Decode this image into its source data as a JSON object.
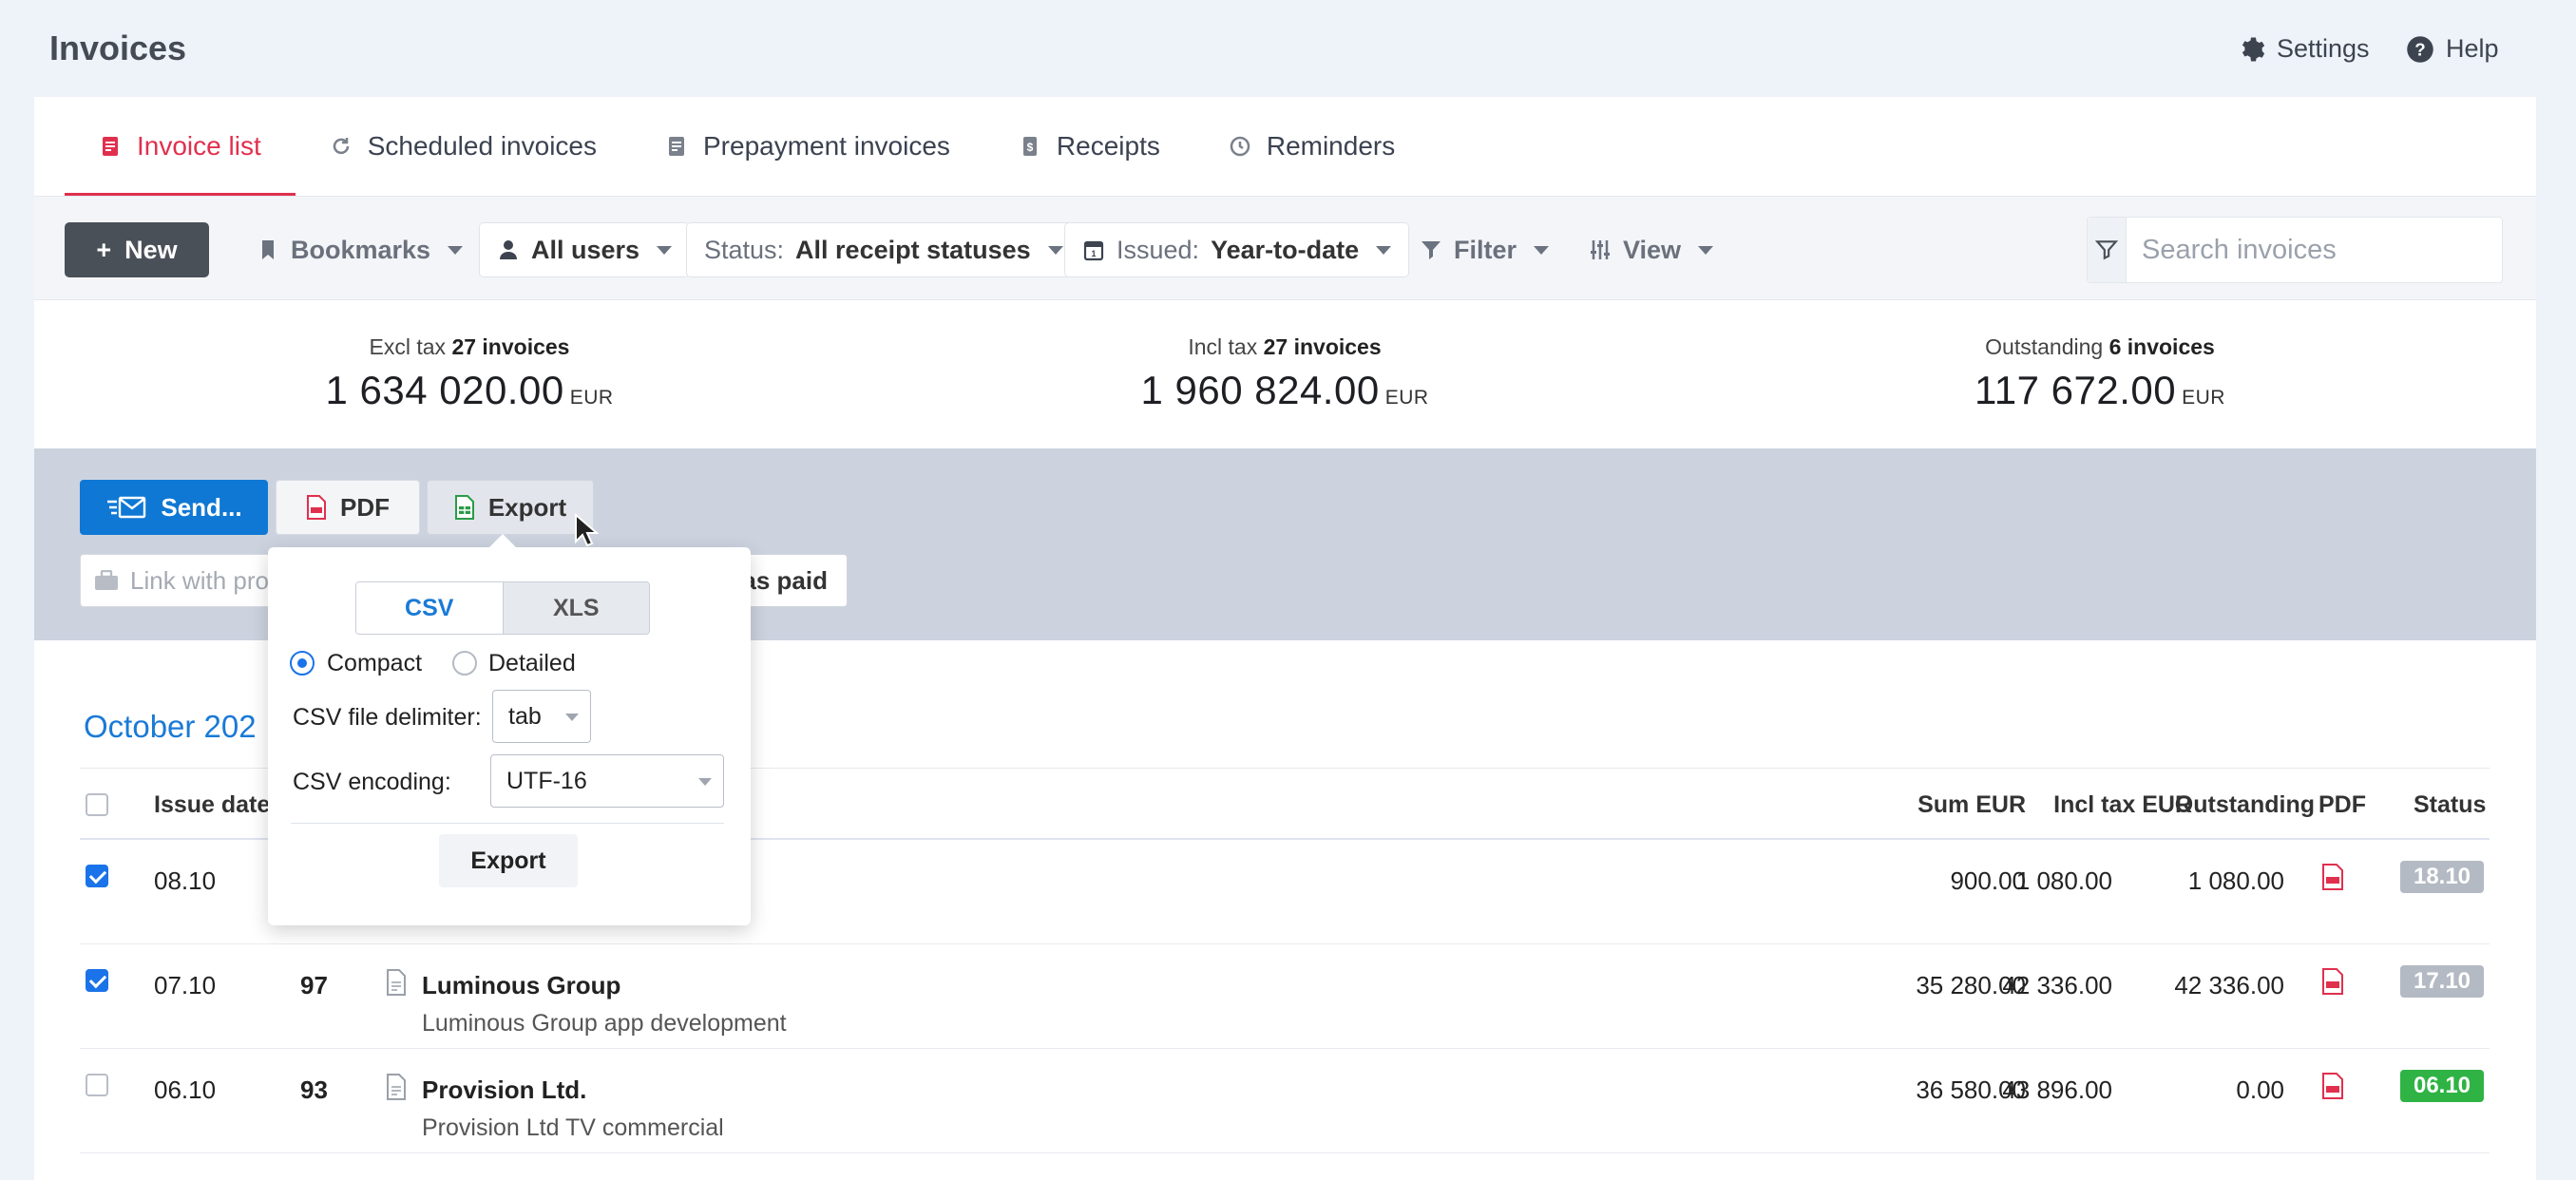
{
  "header": {
    "title": "Invoices",
    "settings_label": "Settings",
    "help_label": "Help"
  },
  "tabs": [
    {
      "label": "Invoice list",
      "icon": "invoice-icon",
      "active": true
    },
    {
      "label": "Scheduled invoices",
      "icon": "refresh-icon"
    },
    {
      "label": "Prepayment invoices",
      "icon": "invoice-icon"
    },
    {
      "label": "Receipts",
      "icon": "receipt-icon"
    },
    {
      "label": "Reminders",
      "icon": "clock-icon"
    }
  ],
  "toolbar": {
    "new_label": "New",
    "bookmarks_label": "Bookmarks",
    "users_label": "All users",
    "status_prefix": "Status:",
    "status_value": "All receipt statuses",
    "issued_prefix": "Issued:",
    "issued_value": "Year-to-date",
    "filter_label": "Filter",
    "view_label": "View",
    "search_placeholder": "Search invoices"
  },
  "totals": [
    {
      "label": "Excl tax",
      "count": "27 invoices",
      "amount": "1 634 020.00",
      "currency": "EUR"
    },
    {
      "label": "Incl tax",
      "count": "27 invoices",
      "amount": "1 960 824.00",
      "currency": "EUR"
    },
    {
      "label": "Outstanding",
      "count": "6 invoices",
      "amount": "117 672.00",
      "currency": "EUR"
    }
  ],
  "actions": {
    "send_label": "Send...",
    "pdf_label": "PDF",
    "export_label": "Export",
    "link_placeholder": "Link with proj",
    "mark_paid_label": "as paid"
  },
  "month_heading": "October 202",
  "table": {
    "columns": [
      "Issue date",
      "Sum EUR",
      "Incl tax EUR",
      "Outstanding",
      "PDF",
      "Status"
    ],
    "rows": [
      {
        "checked": true,
        "date": "08.10",
        "number": "",
        "client": "",
        "description": "",
        "sum": "900.00",
        "incl_tax": "1 080.00",
        "outstanding": "1 080.00",
        "status": "18.10",
        "status_color": "#b4bac3"
      },
      {
        "checked": true,
        "date": "07.10",
        "number": "97",
        "client": "Luminous Group",
        "description": "Luminous Group app development",
        "sum": "35 280.00",
        "incl_tax": "42 336.00",
        "outstanding": "42 336.00",
        "status": "17.10",
        "status_color": "#b4bac3"
      },
      {
        "checked": false,
        "date": "06.10",
        "number": "93",
        "client": "Provision Ltd.",
        "description": "Provision Ltd TV commercial",
        "sum": "36 580.00",
        "incl_tax": "43 896.00",
        "outstanding": "0.00",
        "status": "06.10",
        "status_color": "#2fb344"
      }
    ]
  },
  "export_popover": {
    "format_tabs": [
      "CSV",
      "XLS"
    ],
    "selected_format": "CSV",
    "layout_options": [
      "Compact",
      "Detailed"
    ],
    "selected_layout": "Compact",
    "delimiter_label": "CSV file delimiter:",
    "delimiter_value": "tab",
    "encoding_label": "CSV encoding:",
    "encoding_value": "UTF-16",
    "export_button": "Export"
  },
  "colors": {
    "accent_red": "#e0304e",
    "primary_blue": "#0f78d4",
    "link_blue": "#1a7ad6",
    "status_green": "#2fb344",
    "status_gray": "#b4bac3"
  }
}
